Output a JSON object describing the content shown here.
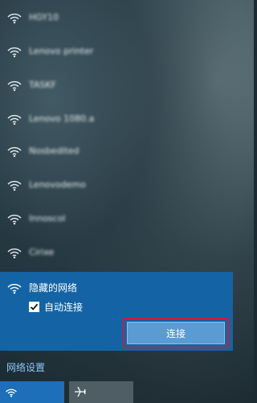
{
  "networks": [
    {
      "name": "HGY10"
    },
    {
      "name": "Lenovo printer"
    },
    {
      "name": "TASKF"
    },
    {
      "name": "Lenovo 1080.a"
    },
    {
      "name": "Nosbedited"
    },
    {
      "name": "Lenovodemo"
    },
    {
      "name": "Innoscol"
    },
    {
      "name": "Cirixe"
    }
  ],
  "selected_network": {
    "name": "隐藏的网络",
    "auto_connect_label": "自动连接",
    "auto_connect_checked": true,
    "connect_button_label": "连接"
  },
  "network_settings_link": "网络设置",
  "quick_actions": [
    {
      "icon": "wifi-icon",
      "state": "on"
    },
    {
      "icon": "airplane-icon",
      "state": "off"
    }
  ],
  "colors": {
    "accent": "#1464a5",
    "button": "#5a9bd4",
    "highlight_border": "#c4203c",
    "link": "#8fc6ff"
  }
}
